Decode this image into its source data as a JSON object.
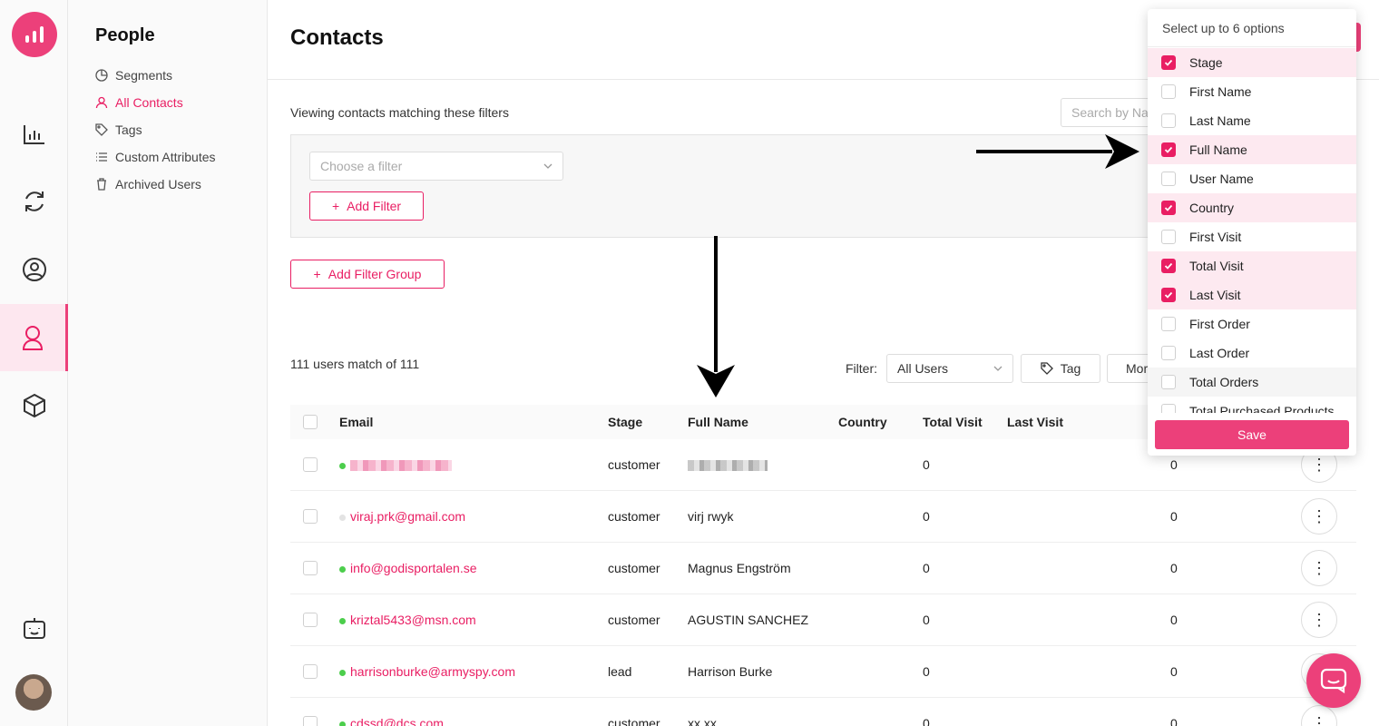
{
  "sidebar": {
    "title": "People",
    "items": [
      {
        "label": "Segments",
        "icon": "segments-icon"
      },
      {
        "label": "All Contacts",
        "icon": "user-icon",
        "active": true
      },
      {
        "label": "Tags",
        "icon": "tag-icon"
      },
      {
        "label": "Custom Attributes",
        "icon": "list-icon"
      },
      {
        "label": "Archived Users",
        "icon": "trash-icon"
      }
    ]
  },
  "header": {
    "title": "Contacts"
  },
  "filters": {
    "viewing_text": "Viewing contacts matching these filters",
    "search_placeholder": "Search by Na",
    "choose_placeholder": "Choose a filter",
    "add_filter": "Add Filter",
    "add_filter_group": "Add Filter Group"
  },
  "toolbar": {
    "match_count": "111 users match of 111",
    "filter_label": "Filter:",
    "filter_value": "All Users",
    "tag_label": "Tag",
    "more_label": "Mor"
  },
  "table": {
    "headers": [
      "Email",
      "Stage",
      "Full Name",
      "Country",
      "Total Visit",
      "Last Visit"
    ],
    "rows": [
      {
        "email": "",
        "online": true,
        "stage": "customer",
        "full_name": "",
        "country": "",
        "total_visit": "0",
        "extra": "0",
        "redacted": true
      },
      {
        "email": "viraj.prk@gmail.com",
        "online": false,
        "stage": "customer",
        "full_name": "virj rwyk",
        "country": "",
        "total_visit": "0",
        "extra": "0"
      },
      {
        "email": "info@godisportalen.se",
        "online": true,
        "stage": "customer",
        "full_name": "Magnus Engström",
        "country": "",
        "total_visit": "0",
        "extra": "0"
      },
      {
        "email": "kriztal5433@msn.com",
        "online": true,
        "stage": "customer",
        "full_name": "AGUSTIN SANCHEZ",
        "country": "",
        "total_visit": "0",
        "extra": "0"
      },
      {
        "email": "harrisonburke@armyspy.com",
        "online": true,
        "stage": "lead",
        "full_name": "Harrison Burke",
        "country": "",
        "total_visit": "0",
        "extra": "0"
      },
      {
        "email": "cdssd@dcs.com",
        "online": true,
        "stage": "customer",
        "full_name": "xx xx",
        "country": "",
        "total_visit": "0",
        "extra": "0"
      }
    ]
  },
  "column_picker": {
    "header": "Select up to 6 options",
    "options": [
      {
        "label": "Stage",
        "checked": true
      },
      {
        "label": "First Name",
        "checked": false
      },
      {
        "label": "Last Name",
        "checked": false
      },
      {
        "label": "Full Name",
        "checked": true
      },
      {
        "label": "User Name",
        "checked": false
      },
      {
        "label": "Country",
        "checked": true
      },
      {
        "label": "First Visit",
        "checked": false
      },
      {
        "label": "Total Visit",
        "checked": true
      },
      {
        "label": "Last Visit",
        "checked": true
      },
      {
        "label": "First Order",
        "checked": false
      },
      {
        "label": "Last Order",
        "checked": false
      },
      {
        "label": "Total Orders",
        "checked": false
      },
      {
        "label": "Total Purchased Products",
        "checked": false
      }
    ],
    "save_label": "Save"
  },
  "colors": {
    "accent": "#e91e63",
    "accent_light": "#fde9f0"
  }
}
